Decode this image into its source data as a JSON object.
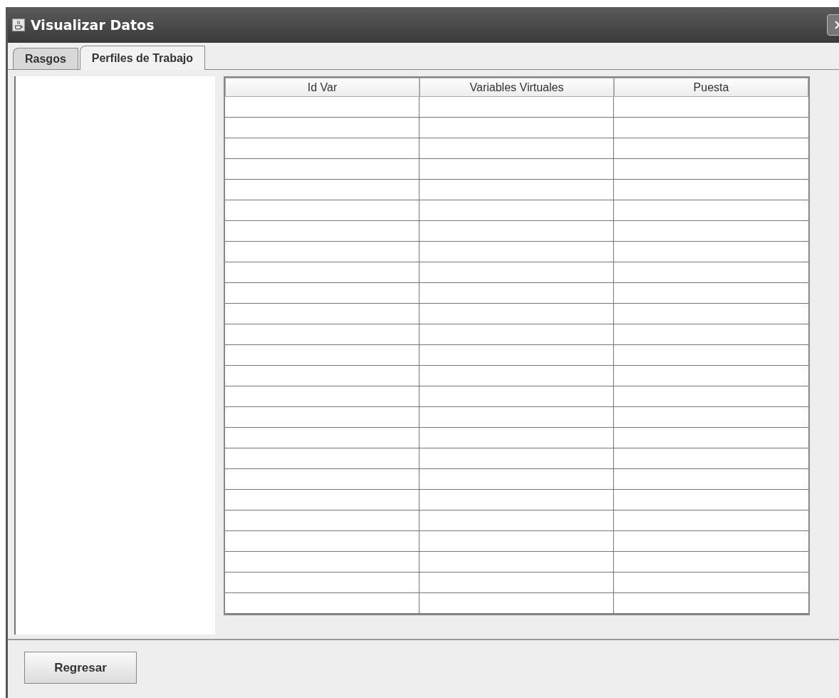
{
  "window": {
    "title": "Visualizar Datos"
  },
  "tabs": [
    {
      "label": "Rasgos",
      "selected": false
    },
    {
      "label": "Perfiles de Trabajo",
      "selected": true
    }
  ],
  "table": {
    "columns": [
      "Id Var",
      "Variables Virtuales",
      "Puesta"
    ]
  },
  "buttons": [
    {
      "label": "Regresar"
    }
  ]
}
